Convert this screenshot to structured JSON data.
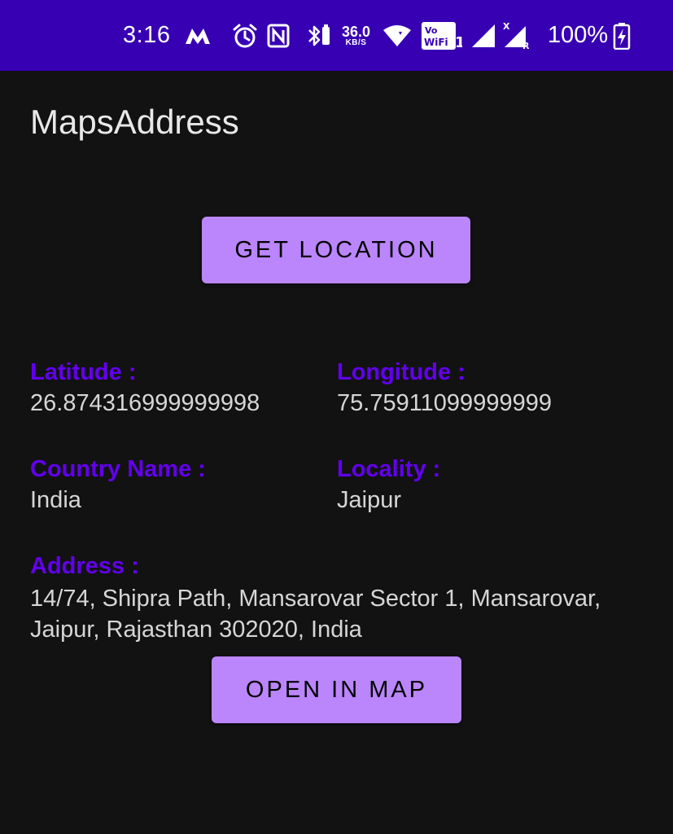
{
  "status_bar": {
    "time": "3:16",
    "net_speed_value": "36.0",
    "net_speed_unit": "KB/S",
    "battery_percent": "100%",
    "icons": [
      "m-app-icon",
      "alarm-icon",
      "nfc-icon",
      "bluetooth-icon",
      "wifi-icon",
      "vowifi-icon",
      "signal-icon",
      "signal-roaming-icon",
      "battery-charging-icon"
    ],
    "background_color": "#3700B3"
  },
  "app": {
    "title": "MapsAddress",
    "background_color": "#121212",
    "accent_color": "#6200EE",
    "button_color": "#BB86FC"
  },
  "actions": {
    "get_location_label": "GET LOCATION",
    "open_in_map_label": "OPEN IN MAP"
  },
  "fields": {
    "latitude": {
      "label": "Latitude :",
      "value": "26.874316999999998"
    },
    "longitude": {
      "label": "Longitude :",
      "value": "75.75911099999999"
    },
    "country": {
      "label": "Country Name :",
      "value": "India"
    },
    "locality": {
      "label": "Locality :",
      "value": "Jaipur"
    },
    "address": {
      "label": "Address :",
      "value": "14/74, Shipra Path, Mansarovar Sector 1, Mansarovar, Jaipur, Rajasthan 302020, India"
    }
  }
}
